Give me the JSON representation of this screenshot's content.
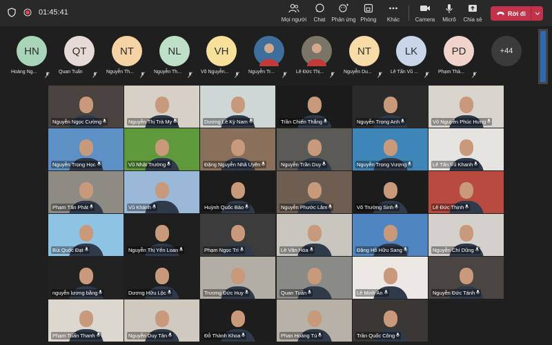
{
  "meeting": {
    "timer": "01:45:41",
    "toolbar": [
      {
        "label": "Mọi người",
        "icon": "people-icon"
      },
      {
        "label": "Chat",
        "icon": "chat-icon"
      },
      {
        "label": "Phản ứng",
        "icon": "reactions-icon"
      },
      {
        "label": "Phòng",
        "icon": "rooms-icon"
      },
      {
        "label": "Khác",
        "icon": "more-icon"
      },
      {
        "label": "Camera",
        "icon": "camera-icon"
      },
      {
        "label": "Micrô",
        "icon": "microphone-icon"
      },
      {
        "label": "Chia sẻ",
        "icon": "share-icon"
      }
    ],
    "leave_label": "Rời đi"
  },
  "strip": {
    "participants": [
      {
        "initials": "HN",
        "name": "Hoàng Ng...",
        "color": "#a8d5b8"
      },
      {
        "initials": "QT",
        "name": "Quan Tuấn",
        "color": "#e6dad6"
      },
      {
        "initials": "NT",
        "name": "Nguyễn Th...",
        "color": "#f5d3a5"
      },
      {
        "initials": "NL",
        "name": "Nguyễn Th...",
        "color": "#bde0c6"
      },
      {
        "initials": "VH",
        "name": "Võ Nguyễn...",
        "color": "#f7e09a"
      },
      {
        "initials": "",
        "name": "Nguyễn Tr...",
        "color": "#3e6f9c"
      },
      {
        "initials": "",
        "name": "Lê Đức Thị...",
        "color": "#7b7568"
      },
      {
        "initials": "NT",
        "name": "Nguyễn Du...",
        "color": "#f7dca8"
      },
      {
        "initials": "LK",
        "name": "Lê Tấn Vũ ...",
        "color": "#c9d6ea"
      },
      {
        "initials": "PD",
        "name": "Phạm Thà...",
        "color": "#f0d4cb"
      }
    ],
    "more": "+44"
  },
  "grid": {
    "tiles": [
      {
        "name": "Nguyễn Ngọc Cường",
        "bg": "#4b4340"
      },
      {
        "name": "Nguyễn Thị Trà My",
        "bg": "#d6d0c6"
      },
      {
        "name": "Dương Lê Kỳ Nam",
        "bg": "#cfd6d6"
      },
      {
        "name": "Trần Chiến Thắng",
        "bg": "#1b1b1b"
      },
      {
        "name": "Nguyễn Trọng Anh",
        "bg": "#2a2a2a"
      },
      {
        "name": "Võ Nguyễn Phúc Hưng",
        "bg": "#d9d4cd"
      },
      {
        "name": "Nguyễn Trọng Học",
        "bg": "#5d90c4"
      },
      {
        "name": "Vũ Nhật Trường",
        "bg": "#5e9a3c"
      },
      {
        "name": "Đặng Nguyễn Nhã Uyên",
        "bg": "#8a6f5a"
      },
      {
        "name": "Nguyễn Trần Duy",
        "bg": "#5c5a57"
      },
      {
        "name": "Nguyễn Trọng Vượng",
        "bg": "#3f86b8"
      },
      {
        "name": "Lê Tấn Vũ Khanh",
        "bg": "#e6e4e1"
      },
      {
        "name": "Phạm Tấn Phát",
        "bg": "#8e8b84"
      },
      {
        "name": "Vũ Khánh",
        "bg": "#9ab8d8"
      },
      {
        "name": "Huỳnh Quốc Bảo",
        "bg": "#1c1c1c"
      },
      {
        "name": "Nguyễn Phước Lâm",
        "bg": "#6e5e52"
      },
      {
        "name": "Võ Trường Sinh",
        "bg": "#1c1c1c"
      },
      {
        "name": "Lê Đức Thịnh",
        "bg": "#b94a3f"
      },
      {
        "name": "Bùi Quốc Đạt",
        "bg": "#8fc3e3"
      },
      {
        "name": "Nguyễn Thị Yến Loan",
        "bg": "#1e1e1e"
      },
      {
        "name": "Phạm Ngọc Trí",
        "bg": "#3c3c3c"
      },
      {
        "name": "Lê Văn Hòa",
        "bg": "#c9c6bf"
      },
      {
        "name": "Đặng Hồ Hữu Sang",
        "bg": "#4f86c1"
      },
      {
        "name": "Nguyễn Chí Dũng",
        "bg": "#d4d0cb"
      },
      {
        "name": "nguyễn lương bằng",
        "bg": "#222222"
      },
      {
        "name": "Dương Hữu Lộc",
        "bg": "#1f1f1f"
      },
      {
        "name": "Trương Đức Huy",
        "bg": "#b3aea5"
      },
      {
        "name": "Quan Tuấn",
        "bg": "#8a8a86"
      },
      {
        "name": "Lê Minh An",
        "bg": "#ece9e4"
      },
      {
        "name": "Nguyễn Đức Tánh",
        "bg": "#4a4442"
      },
      {
        "name": "Phạm Tuấn Thanh",
        "bg": "#ddd8cf"
      },
      {
        "name": "Nguyễn Duy Tân",
        "bg": "#cfc9bf"
      },
      {
        "name": "Đỗ Thành Khoa",
        "bg": "#1d1d1d"
      },
      {
        "name": "Phan Hoàng Tú",
        "bg": "#b7b1a7"
      },
      {
        "name": "Trần Quốc Công",
        "bg": "#3b3735"
      }
    ]
  },
  "colors": {
    "leave": "#c4314b",
    "topbar": "#292929",
    "background": "#1f1f1f",
    "scroll_thumb": "#2a6ab3"
  }
}
